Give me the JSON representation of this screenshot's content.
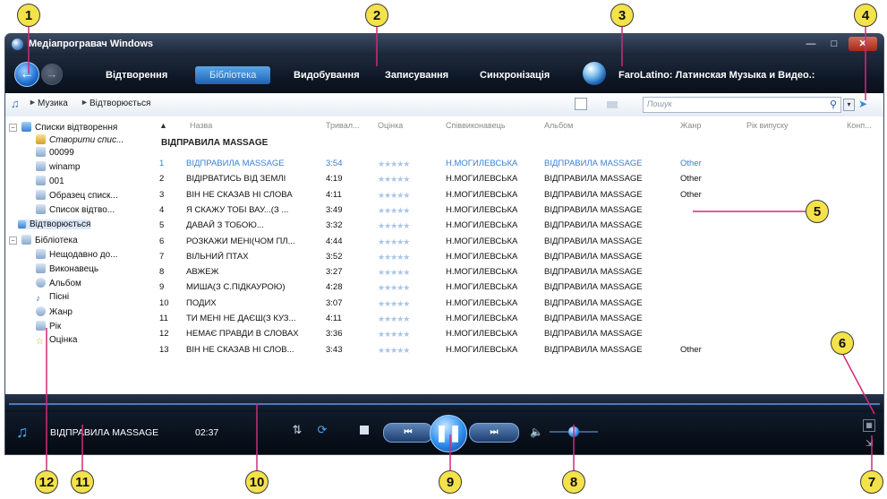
{
  "window": {
    "title": "Медіапрогравач Windows"
  },
  "nav_tabs": [
    {
      "label": "Відтворення"
    },
    {
      "label": "Бібліотека",
      "active": true
    },
    {
      "label": "Видобування"
    },
    {
      "label": "Записування"
    },
    {
      "label": "Синхронізація"
    }
  ],
  "media_info": "FaroLatino: Латинская Музыка и Видео.:",
  "breadcrumb": [
    "Музика",
    "Відтворюється"
  ],
  "search": {
    "placeholder": "Пошук"
  },
  "sidebar": {
    "items": [
      {
        "label": "Списки відтворення"
      },
      {
        "label": "Створити спис..."
      },
      {
        "label": "00099"
      },
      {
        "label": "winamp"
      },
      {
        "label": "001"
      },
      {
        "label": "Образец списк..."
      },
      {
        "label": "Список відтво..."
      },
      {
        "label": "Відтворюється"
      },
      {
        "label": "Бібліотека"
      },
      {
        "label": "Нещодавно до..."
      },
      {
        "label": "Виконавець"
      },
      {
        "label": "Альбом"
      },
      {
        "label": "Пісні"
      },
      {
        "label": "Жанр"
      },
      {
        "label": "Рік"
      },
      {
        "label": "Оцінка"
      }
    ]
  },
  "table": {
    "headers": [
      "Назва",
      "Тривал...",
      "Оцінка",
      "Співвиконавець",
      "Альбом",
      "Жанр",
      "Рік випуску",
      "Конп..."
    ],
    "album_title": "ВІДПРАВИЛА MASSAGE",
    "rows": [
      {
        "n": "1",
        "title": "ВІДПРАВИЛА MASSAGE",
        "dur": "3:54",
        "artist": "Н.МОГИЛЕВСЬКА",
        "album": "ВІДПРАВИЛА MASSAGE",
        "genre": "Other"
      },
      {
        "n": "2",
        "title": "ВІДІРВАТИСЬ ВІД ЗЕМЛІ",
        "dur": "4:19",
        "artist": "Н.МОГИЛЕВСЬКА",
        "album": "ВІДПРАВИЛА MASSAGE",
        "genre": "Other"
      },
      {
        "n": "3",
        "title": "ВІН НЕ СКАЗАВ НІ СЛОВА",
        "dur": "4:11",
        "artist": "Н.МОГИЛЕВСЬКА",
        "album": "ВІДПРАВИЛА MASSAGE",
        "genre": "Other"
      },
      {
        "n": "4",
        "title": "Я СКАЖУ ТОБІ ВАУ...(З ...",
        "dur": "3:49",
        "artist": "Н.МОГИЛЕВСЬКА",
        "album": "ВІДПРАВИЛА MASSAGE",
        "genre": ""
      },
      {
        "n": "5",
        "title": "ДАВАЙ З ТОБОЮ...",
        "dur": "3:32",
        "artist": "Н.МОГИЛЕВСЬКА",
        "album": "ВІДПРАВИЛА MASSAGE",
        "genre": ""
      },
      {
        "n": "6",
        "title": "РОЗКАЖИ МЕНІ(ЧОМ ПЛ...",
        "dur": "4:44",
        "artist": "Н.МОГИЛЕВСЬКА",
        "album": "ВІДПРАВИЛА MASSAGE",
        "genre": ""
      },
      {
        "n": "7",
        "title": "ВІЛЬНИЙ ПТАХ",
        "dur": "3:52",
        "artist": "Н.МОГИЛЕВСЬКА",
        "album": "ВІДПРАВИЛА MASSAGE",
        "genre": ""
      },
      {
        "n": "8",
        "title": "АВЖЕЖ",
        "dur": "3:27",
        "artist": "Н.МОГИЛЕВСЬКА",
        "album": "ВІДПРАВИЛА MASSAGE",
        "genre": ""
      },
      {
        "n": "9",
        "title": "МИША(З С.ПІДКАУРОЮ)",
        "dur": "4:28",
        "artist": "Н.МОГИЛЕВСЬКА",
        "album": "ВІДПРАВИЛА MASSAGE",
        "genre": ""
      },
      {
        "n": "10",
        "title": "ПОДИХ",
        "dur": "3:07",
        "artist": "Н.МОГИЛЕВСЬКА",
        "album": "ВІДПРАВИЛА MASSAGE",
        "genre": ""
      },
      {
        "n": "11",
        "title": "ТИ МЕНІ НЕ ДАЄШ(З КУЗ...",
        "dur": "4:11",
        "artist": "Н.МОГИЛЕВСЬКА",
        "album": "ВІДПРАВИЛА MASSAGE",
        "genre": ""
      },
      {
        "n": "12",
        "title": "НЕМАЄ ПРАВДИ В СЛОВАХ",
        "dur": "3:36",
        "artist": "Н.МОГИЛЕВСЬКА",
        "album": "ВІДПРАВИЛА MASSAGE",
        "genre": ""
      },
      {
        "n": "13",
        "title": "ВІН НЕ СКАЗАВ НІ СЛОВ...",
        "dur": "3:43",
        "artist": "Н.МОГИЛЕВСЬКА",
        "album": "ВІДПРАВИЛА MASSAGE",
        "genre": "Other"
      }
    ]
  },
  "now_playing": {
    "title": "ВІДПРАВИЛА MASSAGE",
    "time": "02:37"
  },
  "player": {
    "volume_fraction": 0.5,
    "state": "playing"
  },
  "callouts": [
    "1",
    "2",
    "3",
    "4",
    "5",
    "6",
    "7",
    "8",
    "9",
    "10",
    "11",
    "12"
  ],
  "colors": {
    "accent": "#1f63b4",
    "callout_fill": "#f4e24a",
    "leader_line": "#d12a7a"
  }
}
